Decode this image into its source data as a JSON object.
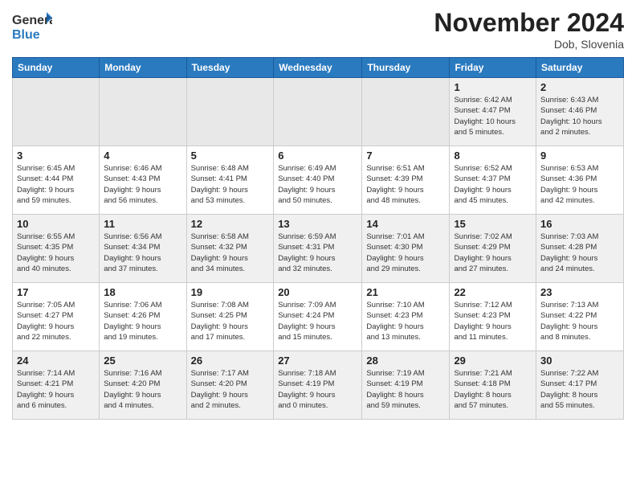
{
  "header": {
    "logo_general": "General",
    "logo_blue": "Blue",
    "title": "November 2024",
    "location": "Dob, Slovenia"
  },
  "days_of_week": [
    "Sunday",
    "Monday",
    "Tuesday",
    "Wednesday",
    "Thursday",
    "Friday",
    "Saturday"
  ],
  "weeks": [
    [
      {
        "num": "",
        "info": ""
      },
      {
        "num": "",
        "info": ""
      },
      {
        "num": "",
        "info": ""
      },
      {
        "num": "",
        "info": ""
      },
      {
        "num": "",
        "info": ""
      },
      {
        "num": "1",
        "info": "Sunrise: 6:42 AM\nSunset: 4:47 PM\nDaylight: 10 hours\nand 5 minutes."
      },
      {
        "num": "2",
        "info": "Sunrise: 6:43 AM\nSunset: 4:46 PM\nDaylight: 10 hours\nand 2 minutes."
      }
    ],
    [
      {
        "num": "3",
        "info": "Sunrise: 6:45 AM\nSunset: 4:44 PM\nDaylight: 9 hours\nand 59 minutes."
      },
      {
        "num": "4",
        "info": "Sunrise: 6:46 AM\nSunset: 4:43 PM\nDaylight: 9 hours\nand 56 minutes."
      },
      {
        "num": "5",
        "info": "Sunrise: 6:48 AM\nSunset: 4:41 PM\nDaylight: 9 hours\nand 53 minutes."
      },
      {
        "num": "6",
        "info": "Sunrise: 6:49 AM\nSunset: 4:40 PM\nDaylight: 9 hours\nand 50 minutes."
      },
      {
        "num": "7",
        "info": "Sunrise: 6:51 AM\nSunset: 4:39 PM\nDaylight: 9 hours\nand 48 minutes."
      },
      {
        "num": "8",
        "info": "Sunrise: 6:52 AM\nSunset: 4:37 PM\nDaylight: 9 hours\nand 45 minutes."
      },
      {
        "num": "9",
        "info": "Sunrise: 6:53 AM\nSunset: 4:36 PM\nDaylight: 9 hours\nand 42 minutes."
      }
    ],
    [
      {
        "num": "10",
        "info": "Sunrise: 6:55 AM\nSunset: 4:35 PM\nDaylight: 9 hours\nand 40 minutes."
      },
      {
        "num": "11",
        "info": "Sunrise: 6:56 AM\nSunset: 4:34 PM\nDaylight: 9 hours\nand 37 minutes."
      },
      {
        "num": "12",
        "info": "Sunrise: 6:58 AM\nSunset: 4:32 PM\nDaylight: 9 hours\nand 34 minutes."
      },
      {
        "num": "13",
        "info": "Sunrise: 6:59 AM\nSunset: 4:31 PM\nDaylight: 9 hours\nand 32 minutes."
      },
      {
        "num": "14",
        "info": "Sunrise: 7:01 AM\nSunset: 4:30 PM\nDaylight: 9 hours\nand 29 minutes."
      },
      {
        "num": "15",
        "info": "Sunrise: 7:02 AM\nSunset: 4:29 PM\nDaylight: 9 hours\nand 27 minutes."
      },
      {
        "num": "16",
        "info": "Sunrise: 7:03 AM\nSunset: 4:28 PM\nDaylight: 9 hours\nand 24 minutes."
      }
    ],
    [
      {
        "num": "17",
        "info": "Sunrise: 7:05 AM\nSunset: 4:27 PM\nDaylight: 9 hours\nand 22 minutes."
      },
      {
        "num": "18",
        "info": "Sunrise: 7:06 AM\nSunset: 4:26 PM\nDaylight: 9 hours\nand 19 minutes."
      },
      {
        "num": "19",
        "info": "Sunrise: 7:08 AM\nSunset: 4:25 PM\nDaylight: 9 hours\nand 17 minutes."
      },
      {
        "num": "20",
        "info": "Sunrise: 7:09 AM\nSunset: 4:24 PM\nDaylight: 9 hours\nand 15 minutes."
      },
      {
        "num": "21",
        "info": "Sunrise: 7:10 AM\nSunset: 4:23 PM\nDaylight: 9 hours\nand 13 minutes."
      },
      {
        "num": "22",
        "info": "Sunrise: 7:12 AM\nSunset: 4:23 PM\nDaylight: 9 hours\nand 11 minutes."
      },
      {
        "num": "23",
        "info": "Sunrise: 7:13 AM\nSunset: 4:22 PM\nDaylight: 9 hours\nand 8 minutes."
      }
    ],
    [
      {
        "num": "24",
        "info": "Sunrise: 7:14 AM\nSunset: 4:21 PM\nDaylight: 9 hours\nand 6 minutes."
      },
      {
        "num": "25",
        "info": "Sunrise: 7:16 AM\nSunset: 4:20 PM\nDaylight: 9 hours\nand 4 minutes."
      },
      {
        "num": "26",
        "info": "Sunrise: 7:17 AM\nSunset: 4:20 PM\nDaylight: 9 hours\nand 2 minutes."
      },
      {
        "num": "27",
        "info": "Sunrise: 7:18 AM\nSunset: 4:19 PM\nDaylight: 9 hours\nand 0 minutes."
      },
      {
        "num": "28",
        "info": "Sunrise: 7:19 AM\nSunset: 4:19 PM\nDaylight: 8 hours\nand 59 minutes."
      },
      {
        "num": "29",
        "info": "Sunrise: 7:21 AM\nSunset: 4:18 PM\nDaylight: 8 hours\nand 57 minutes."
      },
      {
        "num": "30",
        "info": "Sunrise: 7:22 AM\nSunset: 4:17 PM\nDaylight: 8 hours\nand 55 minutes."
      }
    ]
  ]
}
